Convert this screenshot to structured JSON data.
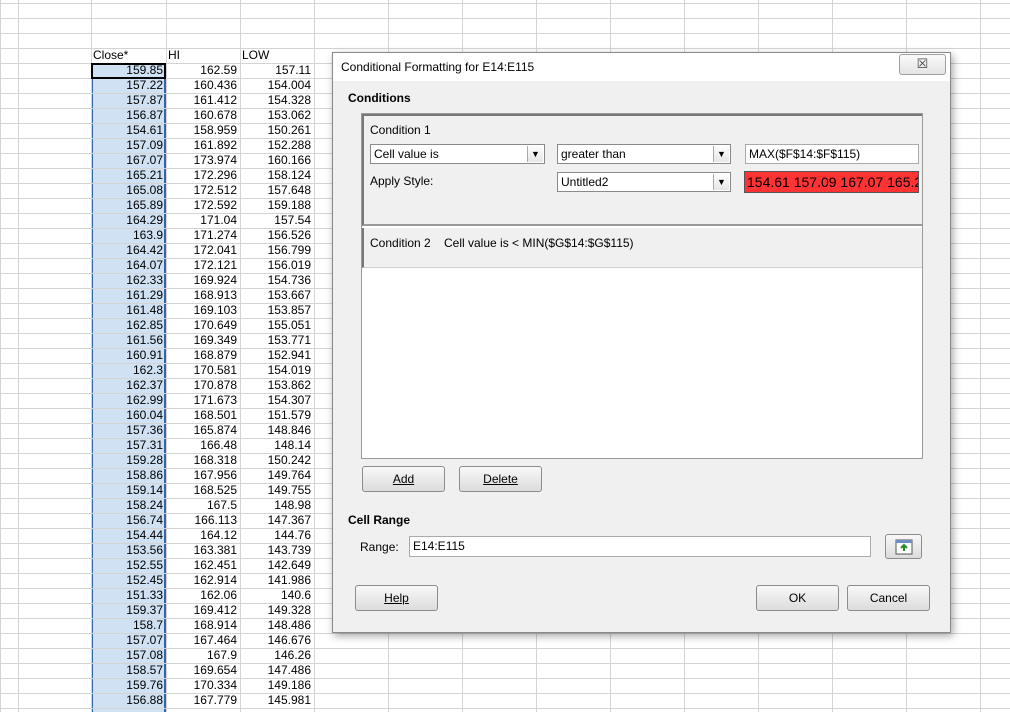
{
  "sheet": {
    "headers": [
      "Close*",
      "HI",
      "LOW"
    ],
    "rows": [
      [
        "159.85",
        "162.59",
        "157.11"
      ],
      [
        "157.22",
        "160.436",
        "154.004"
      ],
      [
        "157.87",
        "161.412",
        "154.328"
      ],
      [
        "156.87",
        "160.678",
        "153.062"
      ],
      [
        "154.61",
        "158.959",
        "150.261"
      ],
      [
        "157.09",
        "161.892",
        "152.288"
      ],
      [
        "167.07",
        "173.974",
        "160.166"
      ],
      [
        "165.21",
        "172.296",
        "158.124"
      ],
      [
        "165.08",
        "172.512",
        "157.648"
      ],
      [
        "165.89",
        "172.592",
        "159.188"
      ],
      [
        "164.29",
        "171.04",
        "157.54"
      ],
      [
        "163.9",
        "171.274",
        "156.526"
      ],
      [
        "164.42",
        "172.041",
        "156.799"
      ],
      [
        "164.07",
        "172.121",
        "156.019"
      ],
      [
        "162.33",
        "169.924",
        "154.736"
      ],
      [
        "161.29",
        "168.913",
        "153.667"
      ],
      [
        "161.48",
        "169.103",
        "153.857"
      ],
      [
        "162.85",
        "170.649",
        "155.051"
      ],
      [
        "161.56",
        "169.349",
        "153.771"
      ],
      [
        "160.91",
        "168.879",
        "152.941"
      ],
      [
        "162.3",
        "170.581",
        "154.019"
      ],
      [
        "162.37",
        "170.878",
        "153.862"
      ],
      [
        "162.99",
        "171.673",
        "154.307"
      ],
      [
        "160.04",
        "168.501",
        "151.579"
      ],
      [
        "157.36",
        "165.874",
        "148.846"
      ],
      [
        "157.31",
        "166.48",
        "148.14"
      ],
      [
        "159.28",
        "168.318",
        "150.242"
      ],
      [
        "158.86",
        "167.956",
        "149.764"
      ],
      [
        "159.14",
        "168.525",
        "149.755"
      ],
      [
        "158.24",
        "167.5",
        "148.98"
      ],
      [
        "156.74",
        "166.113",
        "147.367"
      ],
      [
        "154.44",
        "164.12",
        "144.76"
      ],
      [
        "153.56",
        "163.381",
        "143.739"
      ],
      [
        "152.55",
        "162.451",
        "142.649"
      ],
      [
        "152.45",
        "162.914",
        "141.986"
      ],
      [
        "151.33",
        "162.06",
        "140.6"
      ],
      [
        "159.37",
        "169.412",
        "149.328"
      ],
      [
        "158.7",
        "168.914",
        "148.486"
      ],
      [
        "157.07",
        "167.464",
        "146.676"
      ],
      [
        "157.08",
        "167.9",
        "146.26"
      ],
      [
        "158.57",
        "169.654",
        "147.486"
      ],
      [
        "159.76",
        "170.334",
        "149.186"
      ],
      [
        "156.88",
        "167.779",
        "145.981"
      ]
    ]
  },
  "dialog": {
    "title": "Conditional Formatting for E14:E115",
    "close_glyph": "☒",
    "conditions_label": "Conditions",
    "condition1": {
      "label": "Condition 1",
      "type_value": "Cell value is",
      "operator_value": "greater than",
      "formula_value": "MAX($F$14:$F$115)",
      "apply_style_label": "Apply Style:",
      "style_value": "Untitled2",
      "preview_text": "154.61 157.09 167.07 165.2"
    },
    "condition2": {
      "label": "Condition 2",
      "summary": "Cell value is < MIN($G$14:$G$115)"
    },
    "add_label": "Add",
    "delete_label": "Delete",
    "cell_range_label": "Cell Range",
    "range_label": "Range:",
    "range_value": "E14:E115",
    "help_label": "Help",
    "ok_label": "OK",
    "cancel_label": "Cancel"
  },
  "colors": {
    "selection": "#cfe1f3",
    "preview_bg": "#ff3333",
    "grid": "#d4d4d4"
  }
}
